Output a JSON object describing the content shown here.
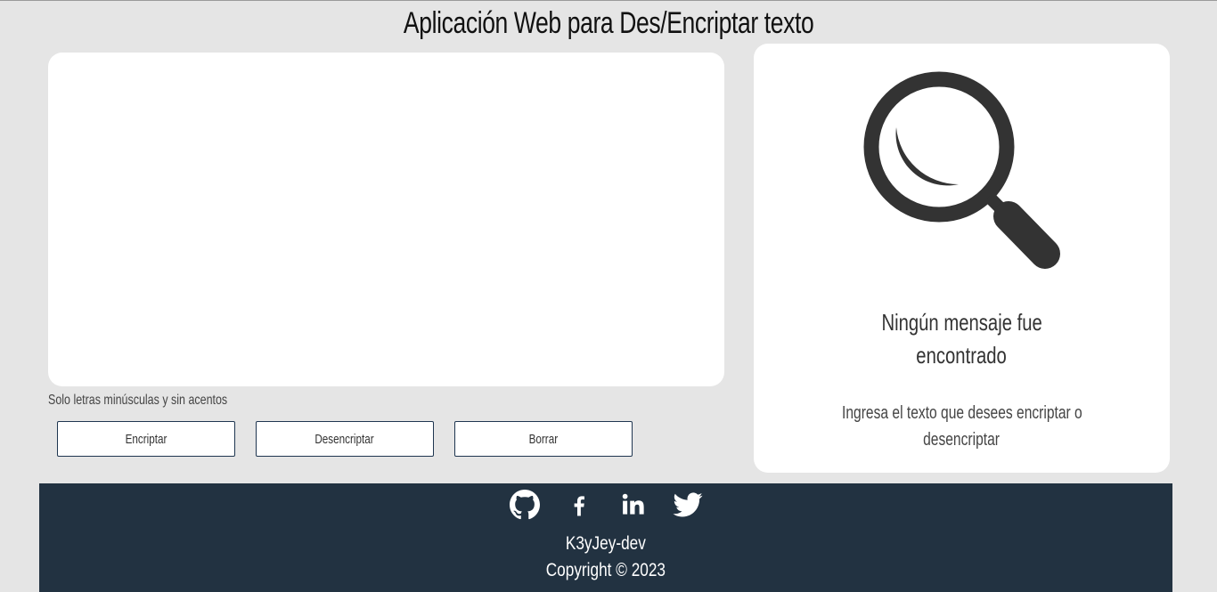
{
  "page": {
    "title": "Aplicación Web para Des/Encriptar texto"
  },
  "input": {
    "value": "",
    "placeholder": "",
    "hint": "Solo letras minúsculas y sin acentos"
  },
  "buttons": {
    "encrypt": "Encriptar",
    "decrypt": "Desencriptar",
    "clear": "Borrar"
  },
  "output": {
    "icon": "magnifier-icon",
    "empty_title_line1": "Ningún mensaje fue",
    "empty_title_line2": "encontrado",
    "empty_desc_line1": "Ingresa el texto que desees encriptar o",
    "empty_desc_line2": "desencriptar"
  },
  "footer": {
    "social": [
      "github-icon",
      "facebook-icon",
      "linkedin-icon",
      "twitter-icon"
    ],
    "author": "K3yJey-dev",
    "copyright": "Copyright © 2023"
  },
  "colors": {
    "background": "#e5e5e5",
    "panel": "#ffffff",
    "footer": "#223241",
    "button_border": "#1f3650",
    "icon": "#333333"
  }
}
